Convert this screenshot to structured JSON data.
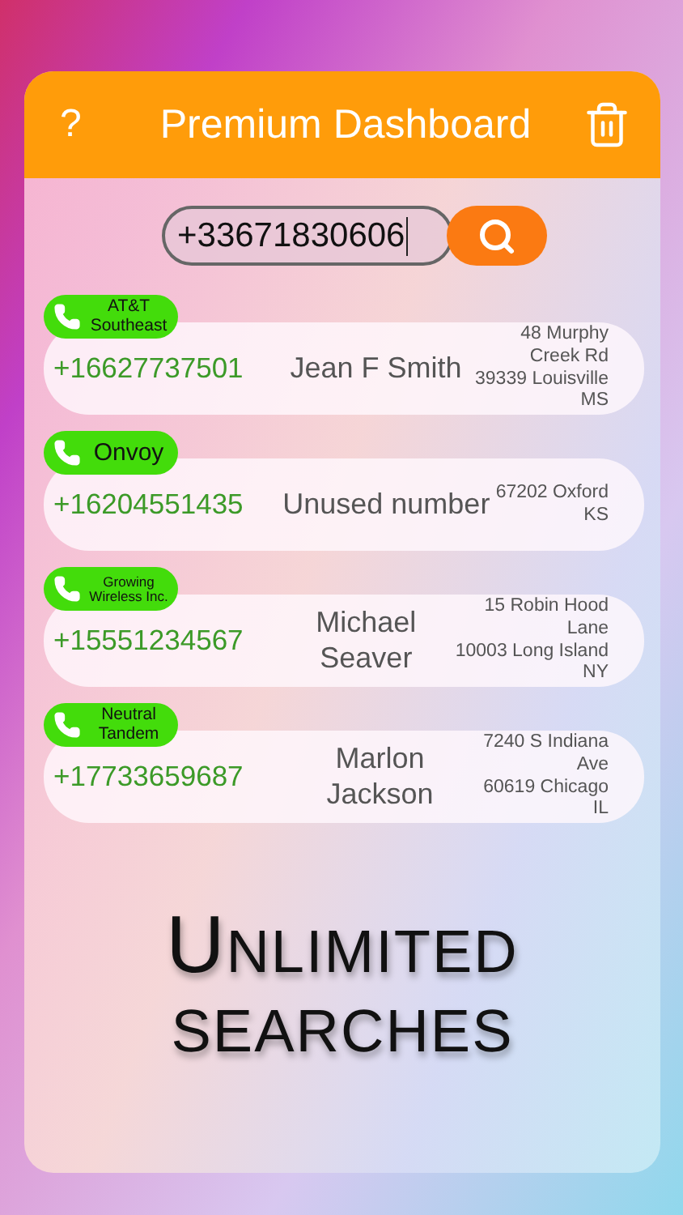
{
  "header": {
    "help": "?",
    "title": "Premium Dashboard"
  },
  "search": {
    "value": "+33671830606"
  },
  "results": [
    {
      "carrier": "AT&T Southeast",
      "phone": "+16627737501",
      "name": "Jean F Smith",
      "address": [
        "48 Murphy",
        "Creek Rd",
        "39339 Louisville",
        "MS"
      ]
    },
    {
      "carrier": "Onvoy",
      "phone": "+16204551435",
      "name": "Unused number",
      "address": [
        "67202 Oxford",
        "KS"
      ]
    },
    {
      "carrier": "Growing Wireless Inc.",
      "phone": "+15551234567",
      "name": "Michael Seaver",
      "address": [
        "15 Robin Hood",
        "Lane",
        "10003 Long Island",
        "NY"
      ]
    },
    {
      "carrier": "Neutral Tandem",
      "phone": "+17733659687",
      "name": "Marlon Jackson",
      "address": [
        "7240 S Indiana",
        "Ave",
        "60619 Chicago",
        "IL"
      ]
    }
  ],
  "promo": {
    "lines": [
      "UNLIMITED",
      "SEARCHES"
    ]
  }
}
